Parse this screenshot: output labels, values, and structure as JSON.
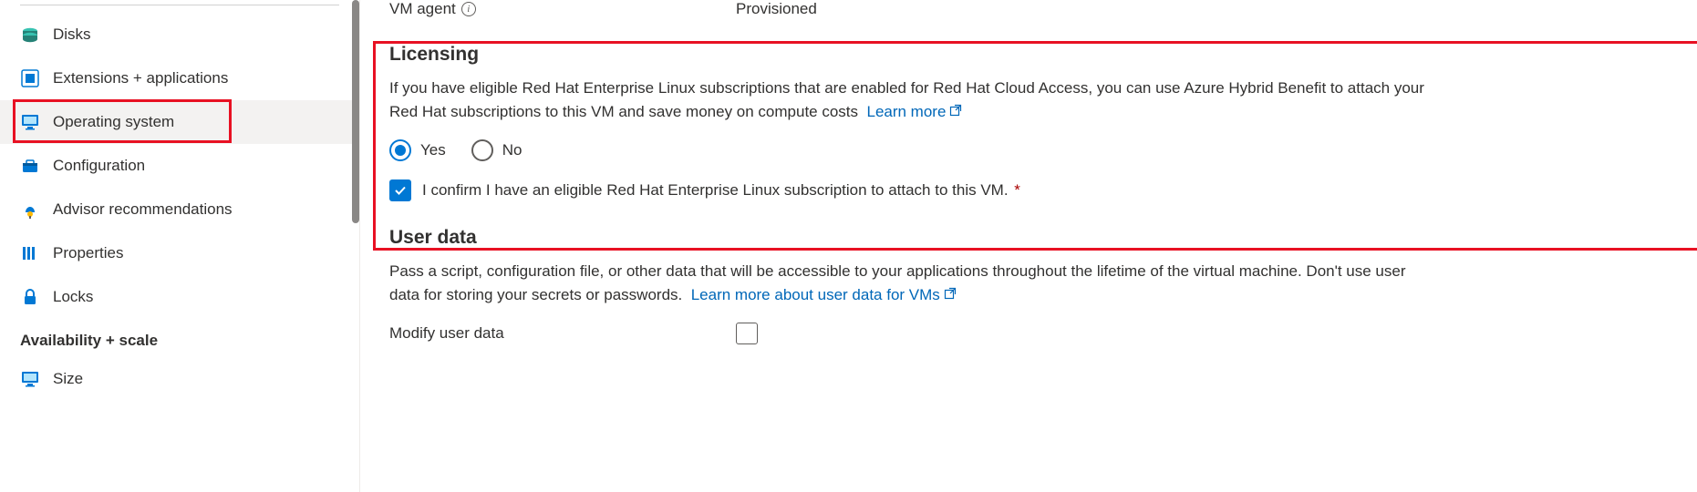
{
  "sidebar": {
    "items": [
      {
        "label": "Disks"
      },
      {
        "label": "Extensions + applications"
      },
      {
        "label": "Operating system"
      },
      {
        "label": "Configuration"
      },
      {
        "label": "Advisor recommendations"
      },
      {
        "label": "Properties"
      },
      {
        "label": "Locks"
      }
    ],
    "groupTitle": "Availability + scale",
    "groupItems": [
      {
        "label": "Size"
      }
    ]
  },
  "main": {
    "vmAgent": {
      "label": "VM agent",
      "value": "Provisioned"
    },
    "licensing": {
      "title": "Licensing",
      "desc": "If you have eligible Red Hat Enterprise Linux subscriptions that are enabled for Red Hat Cloud Access, you can use Azure Hybrid Benefit to attach your Red Hat subscriptions to this VM and save money on compute costs",
      "learnMore": "Learn more",
      "yes": "Yes",
      "no": "No",
      "confirm": "I confirm I have an eligible Red Hat Enterprise Linux subscription to attach to this VM."
    },
    "userData": {
      "title": "User data",
      "desc": "Pass a script, configuration file, or other data that will be accessible to your applications throughout the lifetime of the virtual machine. Don't use user data for storing your secrets or passwords.",
      "learnMore": "Learn more about user data for VMs",
      "modifyLabel": "Modify user data"
    }
  }
}
